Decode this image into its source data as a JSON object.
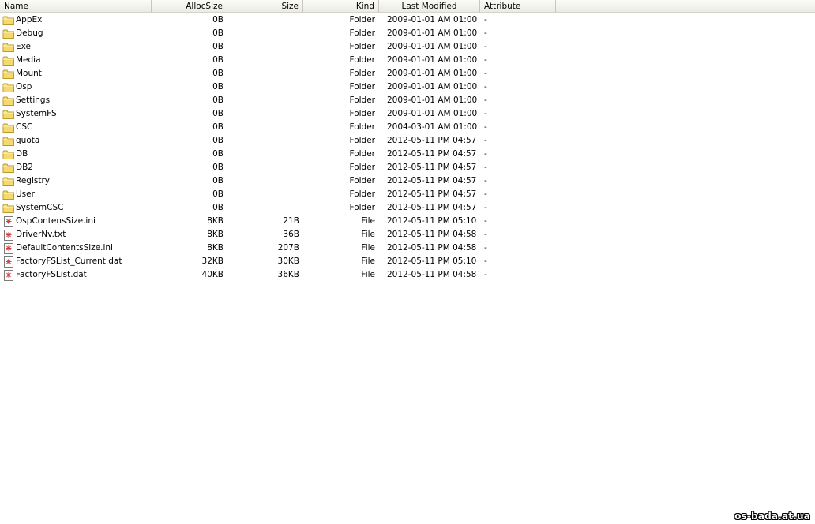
{
  "columns": {
    "name": "Name",
    "allocsize": "AllocSize",
    "size": "Size",
    "kind": "Kind",
    "last_modified": "Last Modified",
    "attribute": "Attribute"
  },
  "rows": [
    {
      "name": "AppEx",
      "allocsize": "0B",
      "size": "",
      "kind": "Folder",
      "modified": "2009-01-01 AM 01:00",
      "attribute": "-",
      "icon": "folder-icon"
    },
    {
      "name": "Debug",
      "allocsize": "0B",
      "size": "",
      "kind": "Folder",
      "modified": "2009-01-01 AM 01:00",
      "attribute": "-",
      "icon": "folder-icon"
    },
    {
      "name": "Exe",
      "allocsize": "0B",
      "size": "",
      "kind": "Folder",
      "modified": "2009-01-01 AM 01:00",
      "attribute": "-",
      "icon": "folder-icon"
    },
    {
      "name": "Media",
      "allocsize": "0B",
      "size": "",
      "kind": "Folder",
      "modified": "2009-01-01 AM 01:00",
      "attribute": "-",
      "icon": "folder-icon"
    },
    {
      "name": "Mount",
      "allocsize": "0B",
      "size": "",
      "kind": "Folder",
      "modified": "2009-01-01 AM 01:00",
      "attribute": "-",
      "icon": "folder-icon"
    },
    {
      "name": "Osp",
      "allocsize": "0B",
      "size": "",
      "kind": "Folder",
      "modified": "2009-01-01 AM 01:00",
      "attribute": "-",
      "icon": "folder-icon"
    },
    {
      "name": "Settings",
      "allocsize": "0B",
      "size": "",
      "kind": "Folder",
      "modified": "2009-01-01 AM 01:00",
      "attribute": "-",
      "icon": "folder-icon"
    },
    {
      "name": "SystemFS",
      "allocsize": "0B",
      "size": "",
      "kind": "Folder",
      "modified": "2009-01-01 AM 01:00",
      "attribute": "-",
      "icon": "folder-icon"
    },
    {
      "name": "CSC",
      "allocsize": "0B",
      "size": "",
      "kind": "Folder",
      "modified": "2004-03-01 AM 01:00",
      "attribute": "-",
      "icon": "folder-icon"
    },
    {
      "name": "quota",
      "allocsize": "0B",
      "size": "",
      "kind": "Folder",
      "modified": "2012-05-11 PM 04:57",
      "attribute": "-",
      "icon": "folder-icon"
    },
    {
      "name": "DB",
      "allocsize": "0B",
      "size": "",
      "kind": "Folder",
      "modified": "2012-05-11 PM 04:57",
      "attribute": "-",
      "icon": "folder-icon"
    },
    {
      "name": "DB2",
      "allocsize": "0B",
      "size": "",
      "kind": "Folder",
      "modified": "2012-05-11 PM 04:57",
      "attribute": "-",
      "icon": "folder-icon"
    },
    {
      "name": "Registry",
      "allocsize": "0B",
      "size": "",
      "kind": "Folder",
      "modified": "2012-05-11 PM 04:57",
      "attribute": "-",
      "icon": "folder-icon"
    },
    {
      "name": "User",
      "allocsize": "0B",
      "size": "",
      "kind": "Folder",
      "modified": "2012-05-11 PM 04:57",
      "attribute": "-",
      "icon": "folder-icon"
    },
    {
      "name": "SystemCSC",
      "allocsize": "0B",
      "size": "",
      "kind": "Folder",
      "modified": "2012-05-11 PM 04:57",
      "attribute": "-",
      "icon": "folder-icon"
    },
    {
      "name": "OspContensSize.ini",
      "allocsize": "8KB",
      "size": "21B",
      "kind": "File",
      "modified": "2012-05-11 PM 05:10",
      "attribute": "-",
      "icon": "file-icon"
    },
    {
      "name": "DriverNv.txt",
      "allocsize": "8KB",
      "size": "36B",
      "kind": "File",
      "modified": "2012-05-11 PM 04:58",
      "attribute": "-",
      "icon": "file-icon"
    },
    {
      "name": "DefaultContentsSize.ini",
      "allocsize": "8KB",
      "size": "207B",
      "kind": "File",
      "modified": "2012-05-11 PM 04:58",
      "attribute": "-",
      "icon": "file-icon"
    },
    {
      "name": "FactoryFSList_Current.dat",
      "allocsize": "32KB",
      "size": "30KB",
      "kind": "File",
      "modified": "2012-05-11 PM 05:10",
      "attribute": "-",
      "icon": "file-icon"
    },
    {
      "name": "FactoryFSList.dat",
      "allocsize": "40KB",
      "size": "36KB",
      "kind": "File",
      "modified": "2012-05-11 PM 04:58",
      "attribute": "-",
      "icon": "file-icon"
    }
  ],
  "watermark": "os-bada.at.ua",
  "colors": {
    "header_bg": "#ecebe5",
    "folder_fill": "#f6d96d",
    "folder_stroke": "#b99b2e",
    "file_mark": "#d23c3c"
  }
}
